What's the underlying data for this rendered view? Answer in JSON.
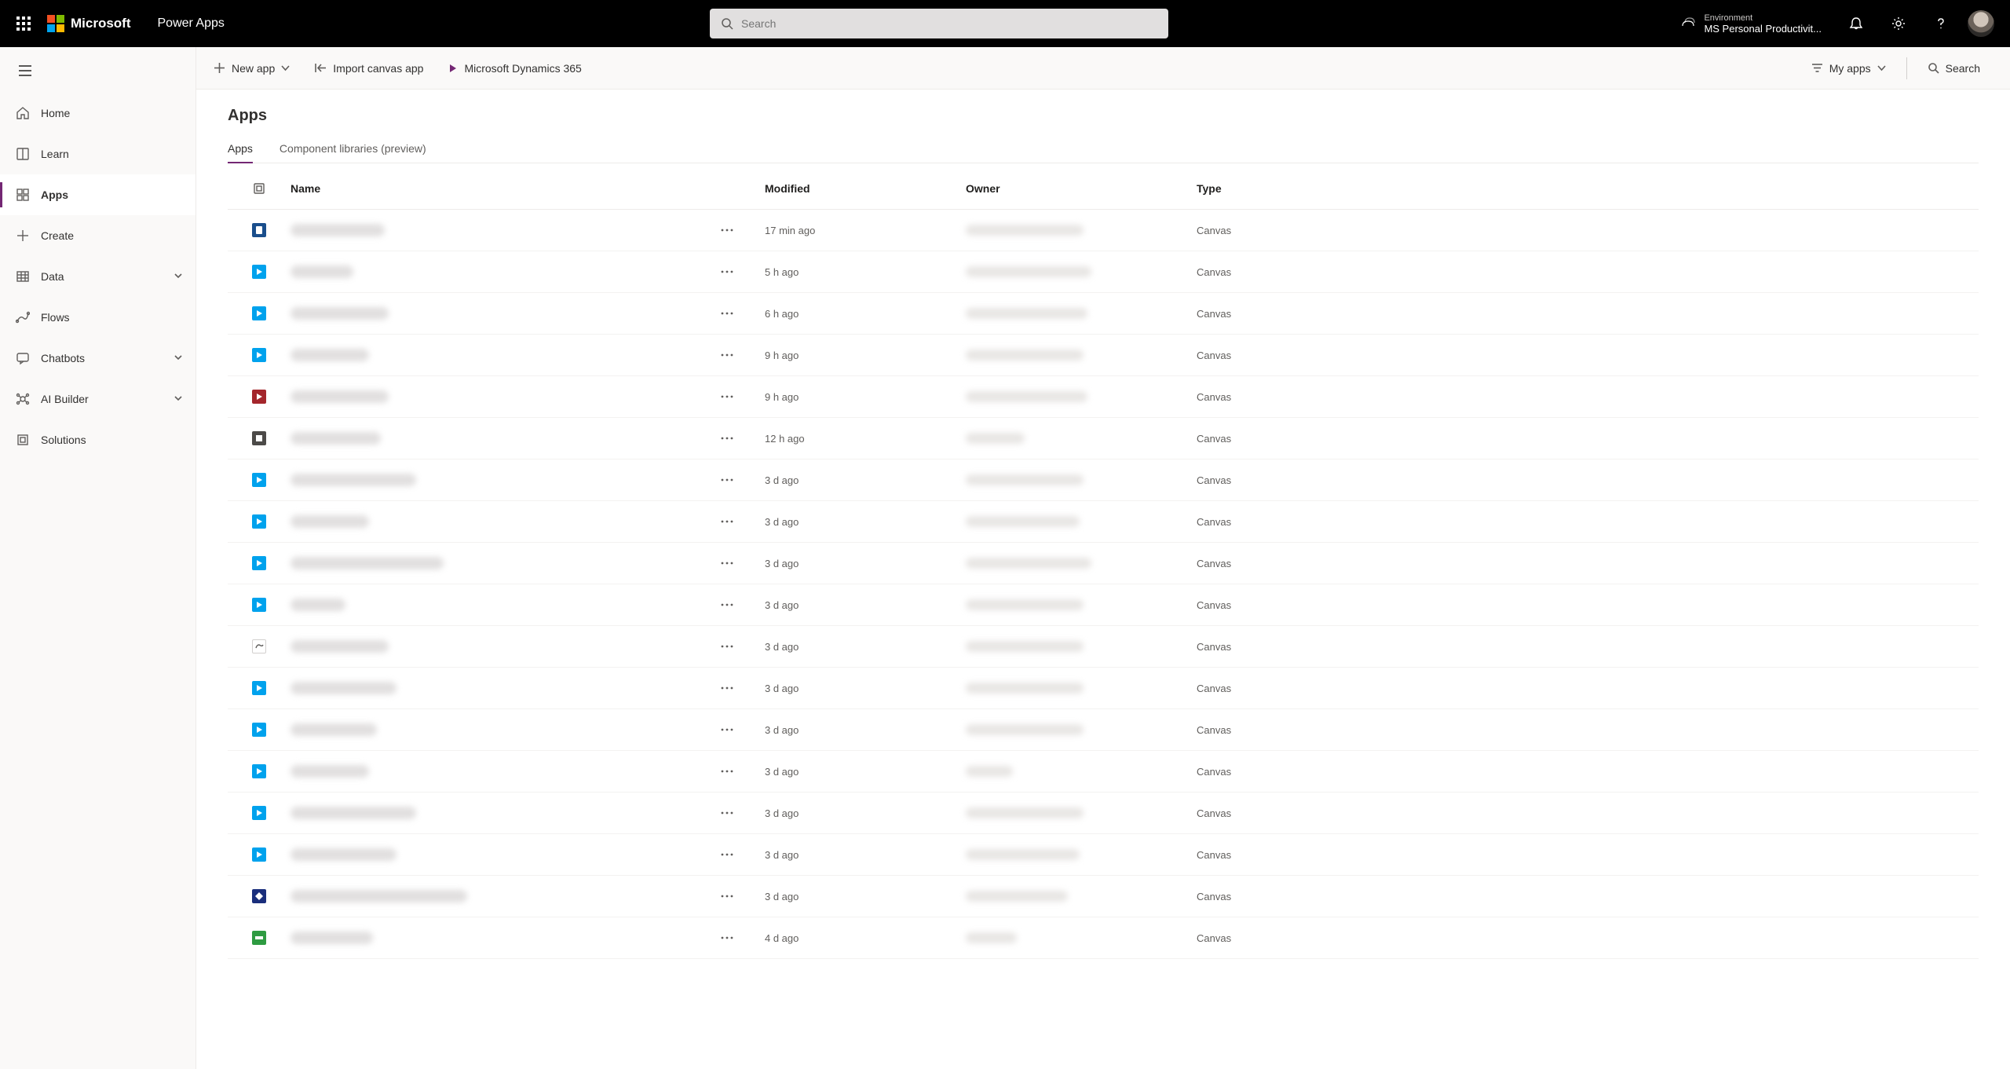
{
  "header": {
    "microsoft": "Microsoft",
    "product": "Power Apps",
    "search_placeholder": "Search",
    "env_label": "Environment",
    "env_value": "MS Personal Productivit..."
  },
  "sidebar": {
    "items": [
      {
        "key": "home",
        "label": "Home"
      },
      {
        "key": "learn",
        "label": "Learn"
      },
      {
        "key": "apps",
        "label": "Apps"
      },
      {
        "key": "create",
        "label": "Create"
      },
      {
        "key": "data",
        "label": "Data",
        "expand": true
      },
      {
        "key": "flows",
        "label": "Flows"
      },
      {
        "key": "chatbots",
        "label": "Chatbots",
        "expand": true
      },
      {
        "key": "aibuilder",
        "label": "AI Builder",
        "expand": true
      },
      {
        "key": "solutions",
        "label": "Solutions"
      }
    ]
  },
  "cmdbar": {
    "new_app": "New app",
    "import_canvas": "Import canvas app",
    "dynamics": "Microsoft Dynamics 365",
    "my_apps": "My apps",
    "search": "Search"
  },
  "page": {
    "title": "Apps",
    "tabs": [
      {
        "key": "apps",
        "label": "Apps"
      },
      {
        "key": "complib",
        "label": "Component libraries (preview)"
      }
    ]
  },
  "table": {
    "headers": {
      "name": "Name",
      "modified": "Modified",
      "owner": "Owner",
      "type": "Type"
    },
    "rows": [
      {
        "color": "#1a4e8c",
        "kind": "doc",
        "nameW": 120,
        "ownerW": 150,
        "modified": "17 min ago",
        "type": "Canvas"
      },
      {
        "color": "#00a2ed",
        "kind": "play",
        "nameW": 80,
        "ownerW": 160,
        "modified": "5 h ago",
        "type": "Canvas"
      },
      {
        "color": "#00a2ed",
        "kind": "play",
        "nameW": 125,
        "ownerW": 155,
        "modified": "6 h ago",
        "type": "Canvas"
      },
      {
        "color": "#00a2ed",
        "kind": "play",
        "nameW": 100,
        "ownerW": 150,
        "modified": "9 h ago",
        "type": "Canvas"
      },
      {
        "color": "#a4262c",
        "kind": "play",
        "nameW": 125,
        "ownerW": 155,
        "modified": "9 h ago",
        "type": "Canvas"
      },
      {
        "color": "#4c4a48",
        "kind": "square",
        "nameW": 115,
        "ownerW": 75,
        "modified": "12 h ago",
        "type": "Canvas"
      },
      {
        "color": "#00a2ed",
        "kind": "play",
        "nameW": 160,
        "ownerW": 150,
        "modified": "3 d ago",
        "type": "Canvas"
      },
      {
        "color": "#00a2ed",
        "kind": "play",
        "nameW": 100,
        "ownerW": 145,
        "modified": "3 d ago",
        "type": "Canvas"
      },
      {
        "color": "#00a2ed",
        "kind": "play",
        "nameW": 195,
        "ownerW": 160,
        "modified": "3 d ago",
        "type": "Canvas"
      },
      {
        "color": "#00a2ed",
        "kind": "play",
        "nameW": 70,
        "ownerW": 150,
        "modified": "3 d ago",
        "type": "Canvas"
      },
      {
        "color": "#ffffff",
        "kind": "scrub",
        "nameW": 125,
        "ownerW": 150,
        "modified": "3 d ago",
        "type": "Canvas"
      },
      {
        "color": "#00a2ed",
        "kind": "play",
        "nameW": 135,
        "ownerW": 150,
        "modified": "3 d ago",
        "type": "Canvas"
      },
      {
        "color": "#00a2ed",
        "kind": "play",
        "nameW": 110,
        "ownerW": 150,
        "modified": "3 d ago",
        "type": "Canvas"
      },
      {
        "color": "#00a2ed",
        "kind": "play",
        "nameW": 100,
        "ownerW": 60,
        "modified": "3 d ago",
        "type": "Canvas"
      },
      {
        "color": "#00a2ed",
        "kind": "play",
        "nameW": 160,
        "ownerW": 150,
        "modified": "3 d ago",
        "type": "Canvas"
      },
      {
        "color": "#00a2ed",
        "kind": "play",
        "nameW": 135,
        "ownerW": 145,
        "modified": "3 d ago",
        "type": "Canvas"
      },
      {
        "color": "#1a2e7c",
        "kind": "diamond",
        "nameW": 225,
        "ownerW": 130,
        "modified": "3 d ago",
        "type": "Canvas"
      },
      {
        "color": "#2e9b41",
        "kind": "csu",
        "nameW": 105,
        "ownerW": 65,
        "modified": "4 d ago",
        "type": "Canvas"
      }
    ]
  }
}
